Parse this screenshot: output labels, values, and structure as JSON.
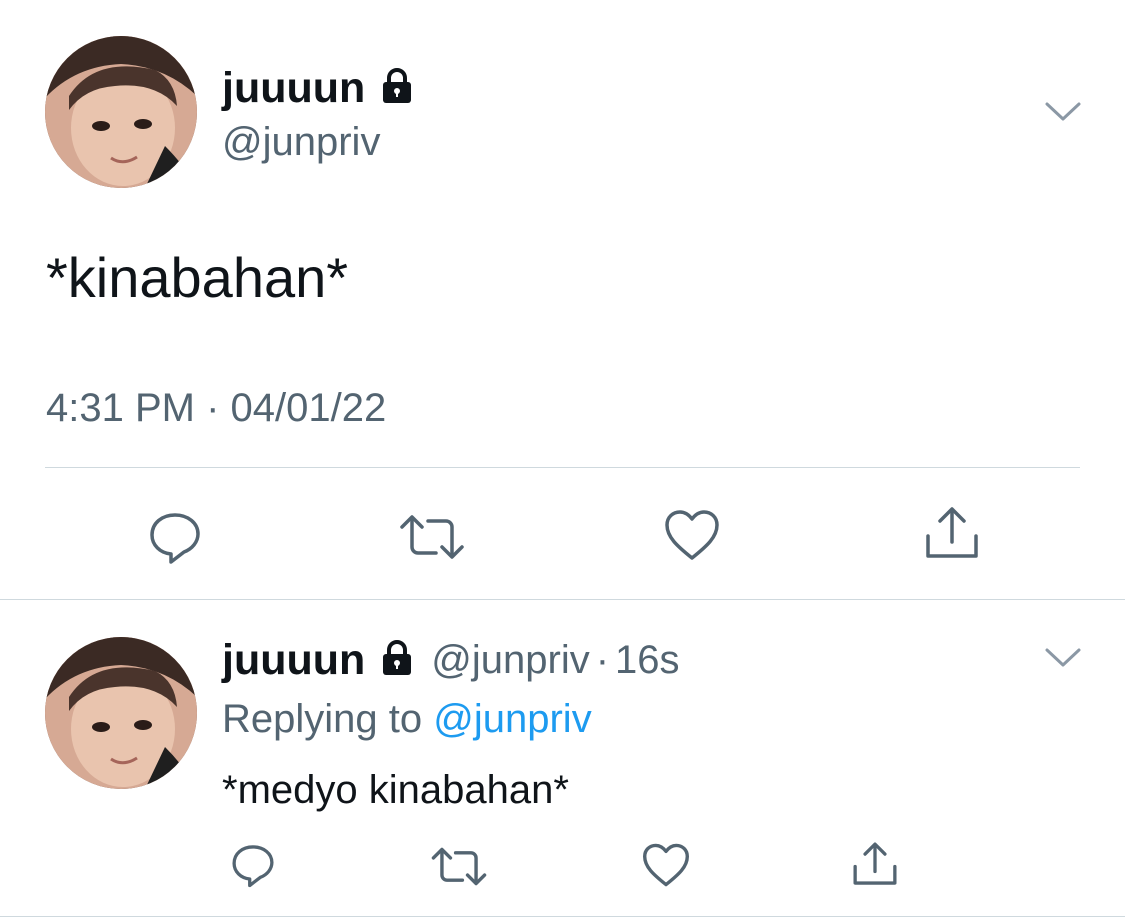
{
  "main_tweet": {
    "display_name": "juuuun",
    "handle": "@junpriv",
    "protected": true,
    "text": "*kinabahan*",
    "time": "4:31 PM",
    "separator": "·",
    "date": "04/01/22"
  },
  "reply_tweet": {
    "display_name": "juuuun",
    "handle": "@junpriv",
    "separator": "·",
    "age": "16s",
    "protected": true,
    "replying_label": "Replying to",
    "replying_to": "@junpriv",
    "text": "*medyo kinabahan*"
  },
  "icons": {
    "menu": "chevron-down-icon",
    "lock": "lock-icon",
    "reply": "reply-icon",
    "retweet": "retweet-icon",
    "like": "heart-icon",
    "share": "share-icon"
  },
  "colors": {
    "text_primary": "#0f1419",
    "text_secondary": "#536471",
    "link": "#1d9bf0",
    "divider": "#cfd9de",
    "icon": "#536471"
  }
}
